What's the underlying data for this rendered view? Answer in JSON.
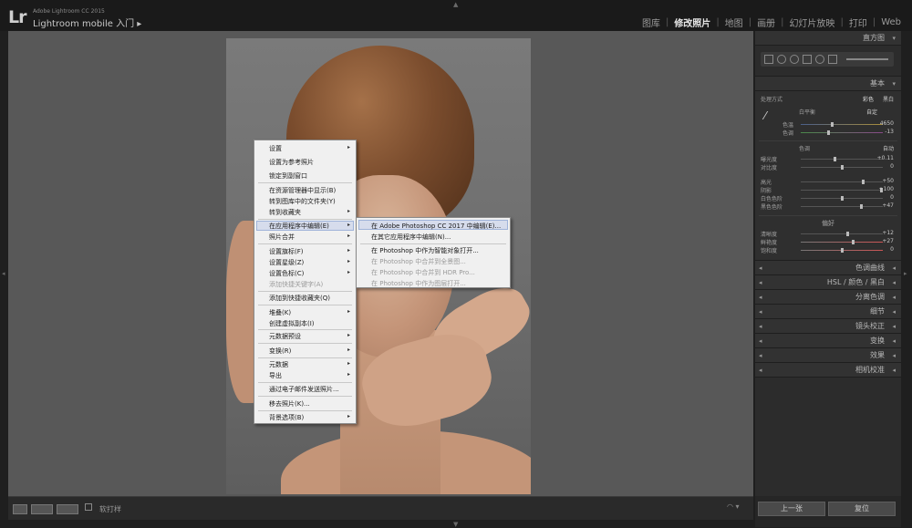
{
  "app": {
    "logo": "Lr",
    "edition": "Adobe Lightroom CC 2015",
    "mobile": "Lightroom mobile 入门"
  },
  "modules": [
    "图库",
    "修改照片",
    "地图",
    "画册",
    "幻灯片放映",
    "打印",
    "Web"
  ],
  "active_module": "修改照片",
  "bottom_bar": {
    "softproof": "软打样"
  },
  "right_panel": {
    "histogram_header": "直方图",
    "basic": {
      "header": "基本",
      "treatment_label": "处理方式",
      "treatment_color": "彩色",
      "treatment_bw": "黑白",
      "wb_label": "白平衡",
      "wb_value": "自定",
      "temp_label": "色温",
      "temp_value": "4650",
      "tint_label": "色调",
      "tint_value": "-13",
      "tone_label": "色调",
      "tone_auto": "自动",
      "exposure_label": "曝光度",
      "exposure_value": "+0.11",
      "contrast_label": "对比度",
      "contrast_value": "0",
      "highlights_label": "高光",
      "highlights_value": "+50",
      "shadows_label": "阴影",
      "shadows_value": "+100",
      "whites_label": "白色色阶",
      "whites_value": "0",
      "blacks_label": "黑色色阶",
      "blacks_value": "+47",
      "presence_label": "偏好",
      "clarity_label": "清晰度",
      "clarity_value": "+12",
      "vibrance_label": "鲜艳度",
      "vibrance_value": "+27",
      "saturation_label": "饱和度",
      "saturation_value": "0"
    },
    "panels": [
      "色调曲线",
      "HSL / 颜色 / 黑白",
      "分离色调",
      "细节",
      "镜头校正",
      "变换",
      "效果",
      "相机校准"
    ],
    "prev_button": "上一张",
    "reset_button": "复位"
  },
  "context_menu": {
    "items": [
      {
        "label": "设置",
        "arrow": true
      },
      {
        "label": "设置为参考照片",
        "arrow": false
      },
      {
        "label": "锁定到副窗口",
        "arrow": false
      },
      {
        "label": "在资源管理器中显示(B)",
        "arrow": false
      },
      {
        "label": "转到图库中的文件夹(Y)",
        "arrow": false
      },
      {
        "label": "转到收藏夹",
        "arrow": true
      },
      {
        "label": "在应用程序中编辑(E)",
        "arrow": true
      },
      {
        "label": "照片合并",
        "arrow": true
      },
      {
        "label": "设置旗标(F)",
        "arrow": true
      },
      {
        "label": "设置星级(Z)",
        "arrow": true
      },
      {
        "label": "设置色标(C)",
        "arrow": true
      },
      {
        "label": "添加快捷关键字(A)",
        "arrow": false,
        "disabled": true
      },
      {
        "label": "添加到快捷收藏夹(Q)",
        "arrow": false
      },
      {
        "label": "堆叠(K)",
        "arrow": true
      },
      {
        "label": "创建虚拟副本(I)",
        "arrow": false
      },
      {
        "label": "元数据预设",
        "arrow": true
      },
      {
        "label": "变换(R)",
        "arrow": true
      },
      {
        "label": "元数据",
        "arrow": true
      },
      {
        "label": "导出",
        "arrow": true
      },
      {
        "label": "通过电子邮件发送照片...",
        "arrow": false
      },
      {
        "label": "移去照片(K)...",
        "arrow": false
      },
      {
        "label": "背景选项(B)",
        "arrow": true
      }
    ]
  },
  "submenu": {
    "items": [
      {
        "label": "在 Adobe Photoshop CC 2017 中编辑(E)...",
        "disabled": false
      },
      {
        "label": "在其它应用程序中编辑(N)...",
        "disabled": false
      },
      {
        "label": "在 Photoshop 中作为智能对象打开...",
        "disabled": false
      },
      {
        "label": "在 Photoshop 中合并到全景图...",
        "disabled": true
      },
      {
        "label": "在 Photoshop 中合并到 HDR Pro...",
        "disabled": true
      },
      {
        "label": "在 Photoshop 中作为图层打开...",
        "disabled": true
      }
    ]
  }
}
